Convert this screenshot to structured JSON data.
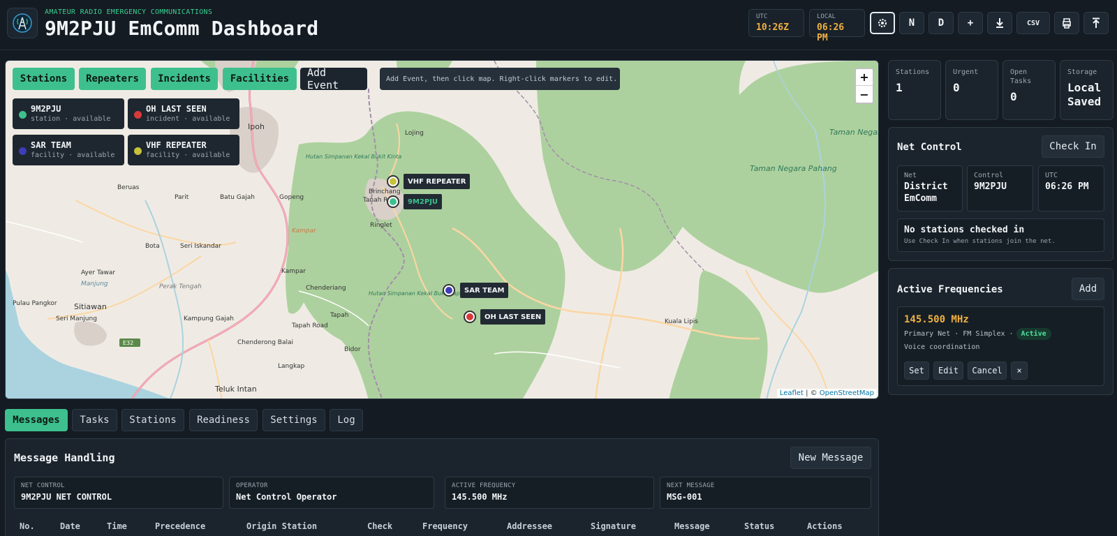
{
  "header": {
    "kicker": "AMATEUR RADIO EMERGENCY COMMUNICATIONS",
    "title": "9M2PJU EmComm Dashboard",
    "utc_label": "UTC",
    "utc_value": "10:26Z",
    "local_label": "LOCAL",
    "local_value": "06:26 PM",
    "buttons": {
      "settings_icon": "gear-icon",
      "n": "N",
      "d": "D",
      "plus": "+",
      "download_icon": "download-icon",
      "csv": "CSV",
      "print_icon": "print-icon",
      "upload_icon": "upload-icon"
    }
  },
  "map": {
    "layer_buttons": [
      "Stations",
      "Repeaters",
      "Incidents",
      "Facilities"
    ],
    "add_event": "Add Event",
    "hint": "Add Event, then click map. Right-click markers to edit.",
    "zoom_in": "+",
    "zoom_out": "−",
    "legend": [
      {
        "name": "9M2PJU",
        "sub": "station · available",
        "color": "#3dc08e"
      },
      {
        "name": "OH LAST SEEN",
        "sub": "incident · available",
        "color": "#d83a3a"
      },
      {
        "name": "SAR TEAM",
        "sub": "facility · available",
        "color": "#3d3db8"
      },
      {
        "name": "VHF REPEATER",
        "sub": "facility · available",
        "color": "#c6c23a"
      }
    ],
    "markers": {
      "vhf": "VHF REPEATER",
      "station": "9M2PJU",
      "sar": "SAR TEAM",
      "oh": "OH LAST SEEN"
    },
    "places": {
      "ipoh": "Ipoh",
      "lojing": "Lojing",
      "beruas": "Beruas",
      "parit": "Parit",
      "batu_gajah": "Batu Gajah",
      "gopeng": "Gopeng",
      "brinchang": "Brinchang",
      "tanah_rata": "Tanah Rata",
      "ringlet": "Ringlet",
      "bota": "Bota",
      "seri_iskandar": "Seri Iskandar",
      "ayer_tawar": "Ayer Tawar",
      "manjung": "Manjung",
      "perak_tengah": "Perak Tengah",
      "pulau_pangkor": "Pulau Pangkor",
      "sitiawan": "Sitiawan",
      "seri_manjung": "Seri Manjung",
      "kampar": "Kampar",
      "chenderiang": "Chenderiang",
      "kampung_gajah": "Kampung Gajah",
      "tapah": "Tapah",
      "tapah_road": "Tapah Road",
      "chenderong_balai": "Chenderong Balai",
      "bidor": "Bidor",
      "langkap": "Langkap",
      "teluk_intan": "Teluk Intan",
      "kuala_lipis": "Kuala Lipis",
      "e32": "E32",
      "taman_negara_malaysia": "Taman Negara Malaysia",
      "taman_negara_pahang": "Taman Negara Pahang",
      "hutan_kinta": "Hutan Simpanan Kekal Bukit Kinta",
      "hutan_tapah": "Hutan Simpanan Kekal Bukit Tapah",
      "kampar_district": "Kampar"
    },
    "attribution_leaflet": "Leaflet",
    "attribution_sep": " | © ",
    "attribution_osm": "OpenStreetMap"
  },
  "tabs": [
    "Messages",
    "Tasks",
    "Stations",
    "Readiness",
    "Settings",
    "Log"
  ],
  "messages": {
    "title": "Message Handling",
    "new_button": "New Message",
    "fields": [
      {
        "key": "NET CONTROL",
        "value": "9M2PJU NET CONTROL"
      },
      {
        "key": "OPERATOR",
        "value": "Net Control Operator"
      },
      {
        "key": "ACTIVE FREQUENCY",
        "value": "145.500 MHz"
      },
      {
        "key": "NEXT MESSAGE",
        "value": "MSG-001"
      }
    ],
    "columns": [
      "No.",
      "Date",
      "Time",
      "Precedence",
      "Origin Station",
      "Check",
      "Frequency",
      "Addressee",
      "Signature",
      "Message",
      "Status",
      "Actions"
    ]
  },
  "stats": [
    {
      "label": "Stations",
      "value": "1"
    },
    {
      "label": "Urgent",
      "value": "0"
    },
    {
      "label": "Open Tasks",
      "value": "0"
    },
    {
      "label": "Storage",
      "value": "Local Saved"
    }
  ],
  "net_control": {
    "title": "Net Control",
    "check_in": "Check In",
    "net_label": "Net",
    "net_value": "District EmComm",
    "control_label": "Control",
    "control_value": "9M2PJU",
    "utc_label": "UTC",
    "utc_value": "06:26 PM",
    "empty_title": "No stations checked in",
    "empty_sub": "Use Check In when stations join the net."
  },
  "frequencies": {
    "title": "Active Frequencies",
    "add": "Add",
    "freq": "145.500 MHz",
    "meta": "Primary Net · FM Simplex ·",
    "status": "Active",
    "desc": "Voice coordination",
    "actions": [
      "Set",
      "Edit",
      "Cancel",
      "×"
    ]
  }
}
